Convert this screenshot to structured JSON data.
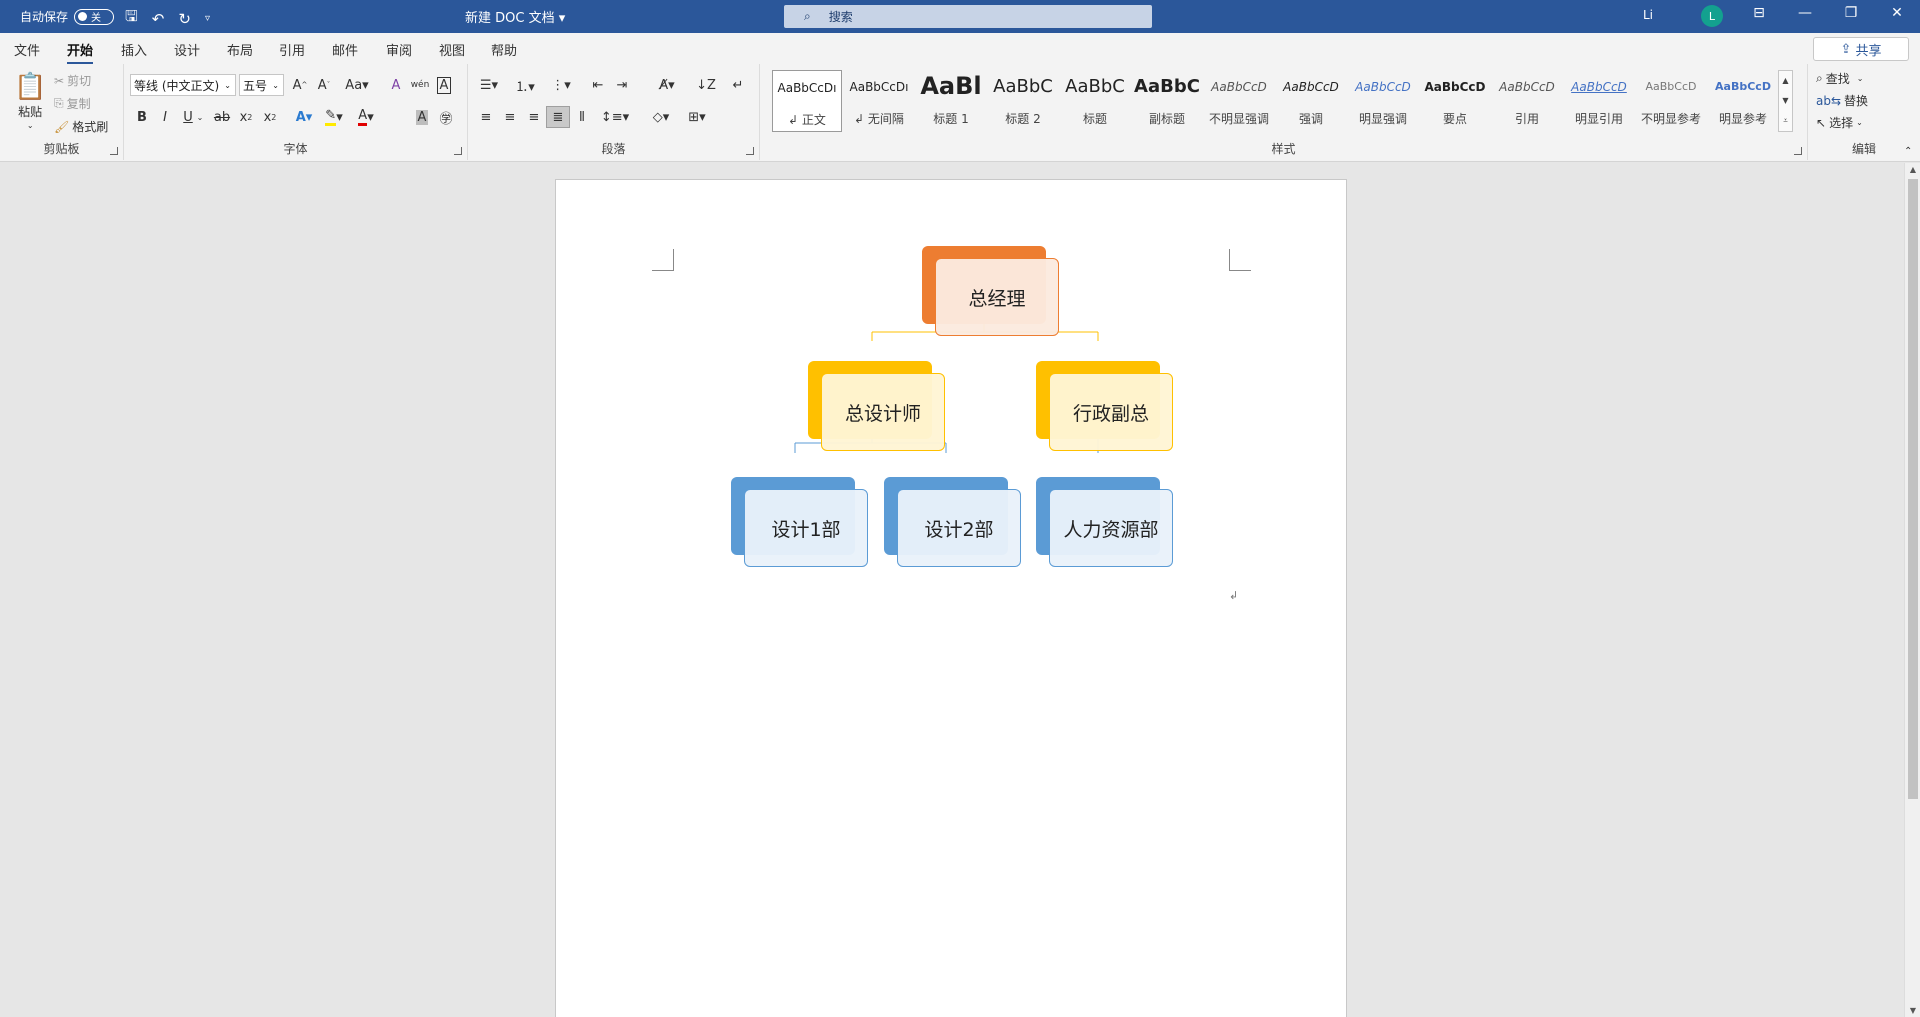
{
  "titlebar": {
    "autosave_label": "自动保存",
    "autosave_state": "关",
    "doc_title": "新建 DOC 文档",
    "search_placeholder": "搜索",
    "user_name": "Li",
    "avatar_initial": "L"
  },
  "menu": {
    "tabs": [
      "文件",
      "开始",
      "插入",
      "设计",
      "布局",
      "引用",
      "邮件",
      "审阅",
      "视图",
      "帮助"
    ],
    "active": "开始",
    "share_label": "共享"
  },
  "ribbon": {
    "clipboard": {
      "label": "剪贴板",
      "paste": "粘贴",
      "cut": "剪切",
      "copy": "复制",
      "format_painter": "格式刷"
    },
    "font": {
      "label": "字体",
      "font_name": "等线 (中文正文)",
      "font_size": "五号"
    },
    "paragraph": {
      "label": "段落"
    },
    "styles": {
      "label": "样式",
      "items": [
        {
          "sample": "AaBbCcDı",
          "name": "正文"
        },
        {
          "sample": "AaBbCcDı",
          "name": "无间隔"
        },
        {
          "sample": "AaBl",
          "name": "标题 1"
        },
        {
          "sample": "AaBbC",
          "name": "标题 2"
        },
        {
          "sample": "AaBbC",
          "name": "标题"
        },
        {
          "sample": "AaBbC",
          "name": "副标题"
        },
        {
          "sample": "AaBbCcD",
          "name": "不明显强调"
        },
        {
          "sample": "AaBbCcD",
          "name": "强调"
        },
        {
          "sample": "AaBbCcD",
          "name": "明显强调"
        },
        {
          "sample": "AaBbCcD",
          "name": "要点"
        },
        {
          "sample": "AaBbCcD",
          "name": "引用"
        },
        {
          "sample": "AaBbCcD",
          "name": "明显引用"
        },
        {
          "sample": "AaBbCcD",
          "name": "不明显参考"
        },
        {
          "sample": "AaBbCcD",
          "name": "明显参考"
        }
      ]
    },
    "editing": {
      "label": "编辑",
      "find": "查找",
      "replace": "替换",
      "select": "选择"
    }
  },
  "orgchart": {
    "ceo": "总经理",
    "chief_designer": "总设计师",
    "admin_vp": "行政副总",
    "design1": "设计1部",
    "design2": "设计2部",
    "hr": "人力资源部"
  },
  "colors": {
    "accent": "#2b579a",
    "orange": "#ed7d31",
    "gold": "#ffc000",
    "blue": "#5b9bd5"
  }
}
